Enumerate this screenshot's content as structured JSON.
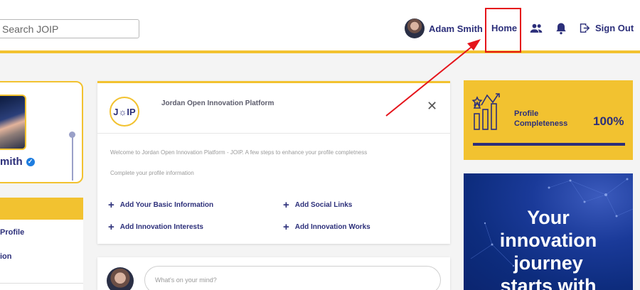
{
  "header": {
    "search_placeholder": "Search JOIP",
    "user_name": "Adam Smith",
    "nav_home": "Home",
    "sign_out": "Sign Out"
  },
  "profile": {
    "name_partial": "mith",
    "menu_items": [
      "Profile",
      "ion"
    ]
  },
  "welcome": {
    "logo_text": "J☼IP",
    "title": "Jordan Open Innovation Platform",
    "intro": "Welcome to Jordan Open Innovation Platform - JOIP. A few steps to enhance your profile completness",
    "subtitle": "Complete your profile information",
    "links": [
      "Add Your Basic Information",
      "Add Social Links",
      "Add Innovation Interests",
      "Add Innovation Works"
    ]
  },
  "composer": {
    "placeholder": "What's on your mind?"
  },
  "completeness": {
    "label_line1": "Profile",
    "label_line2": "Completeness",
    "percent": "100%",
    "fraction": 1.0
  },
  "banner": {
    "line1": "Your",
    "line2": "innovation",
    "line3": "journey",
    "line4": "starts with"
  },
  "colors": {
    "accent": "#f2c230",
    "navy": "#2c2f7a",
    "highlight": "#e5141b"
  }
}
